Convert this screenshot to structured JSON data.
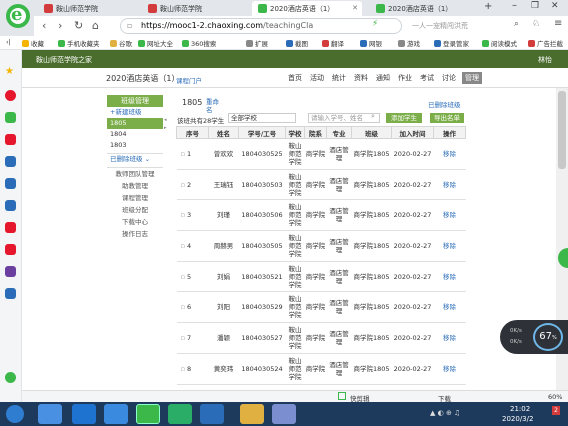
{
  "browser": {
    "tabs": [
      {
        "label": "鞍山师范学院",
        "active": false
      },
      {
        "label": "鞍山师范学院",
        "active": false
      },
      {
        "label": "2020酒店英语（1）",
        "active": true
      },
      {
        "label": "2020酒店英语（1）",
        "active": false
      }
    ],
    "url_host": "https://mooc1-2.chaoxing.com",
    "url_rest": "/teachingCla",
    "search_placeholder": "一人一宠精闯洪荒",
    "bookmarks": [
      "收藏",
      "手机收藏夹",
      "谷歌",
      "网址大全",
      "360搜索",
      "扩展",
      "截图",
      "翻译",
      "网银",
      "游戏",
      "登录管家",
      "阅读模式",
      "广告拦截"
    ]
  },
  "site": {
    "school": "鞍山师范学院之家",
    "user": "林怡"
  },
  "course": {
    "name": "2020酒店英语（1）",
    "portal": "课程门户",
    "nav": [
      "首页",
      "活动",
      "统计",
      "资料",
      "通知",
      "作业",
      "考试",
      "讨论",
      "管理"
    ],
    "active_nav": "管理"
  },
  "left_menu": {
    "header": "班级管理",
    "new_class": "+新建班级",
    "classes": [
      "1805",
      "1804",
      "1803"
    ],
    "selected_class": "1805",
    "closed_classes": "已删除班级 ⌄",
    "links": [
      "教师团队管理",
      "助教管理",
      "课程管理",
      "班级分配",
      "下载中心",
      "操作日志"
    ]
  },
  "class_panel": {
    "title": "1805",
    "rename": "重命名",
    "deleted_classes_link": "已删除班级",
    "student_count_text": "该班共有28学生",
    "school_filter": "全部学校",
    "search_placeholder": "请输入学号、姓名",
    "add_student": "添加学生",
    "export": "导出名单"
  },
  "table": {
    "headers": [
      "序号",
      "姓名",
      "学号/工号",
      "学校",
      "院系",
      "专业",
      "班级",
      "加入时间",
      "操作"
    ],
    "rows": [
      {
        "no": "1",
        "name": "曾欢欢",
        "id": "1804030525",
        "school": "鞍山师范学院",
        "dept": "商学院",
        "major": "酒店管理",
        "cls": "商学院1805",
        "date": "2020-02-27",
        "action": "移除"
      },
      {
        "no": "2",
        "name": "王瑞钰",
        "id": "1804030503",
        "school": "鞍山师范学院",
        "dept": "商学院",
        "major": "酒店管理",
        "cls": "商学院1805",
        "date": "2020-02-27",
        "action": "移除"
      },
      {
        "no": "3",
        "name": "刘瑾",
        "id": "1804030506",
        "school": "鞍山师范学院",
        "dept": "商学院",
        "major": "酒店管理",
        "cls": "商学院1805",
        "date": "2020-02-27",
        "action": "移除"
      },
      {
        "no": "4",
        "name": "周赫男",
        "id": "1804030505",
        "school": "鞍山师范学院",
        "dept": "商学院",
        "major": "酒店管理",
        "cls": "商学院1805",
        "date": "2020-02-27",
        "action": "移除"
      },
      {
        "no": "5",
        "name": "刘娟",
        "id": "1804030521",
        "school": "鞍山师范学院",
        "dept": "商学院",
        "major": "酒店管理",
        "cls": "商学院1805",
        "date": "2020-02-27",
        "action": "移除"
      },
      {
        "no": "6",
        "name": "刘阳",
        "id": "1804030529",
        "school": "鞍山师范学院",
        "dept": "商学院",
        "major": "酒店管理",
        "cls": "商学院1805",
        "date": "2020-02-27",
        "action": "移除"
      },
      {
        "no": "7",
        "name": "潘颖",
        "id": "1804030527",
        "school": "鞍山师范学院",
        "dept": "商学院",
        "major": "酒店管理",
        "cls": "商学院1805",
        "date": "2020-02-27",
        "action": "移除"
      },
      {
        "no": "8",
        "name": "黄奕玮",
        "id": "1804030524",
        "school": "鞍山师范学院",
        "dept": "商学院",
        "major": "酒店管理",
        "cls": "商学院1805",
        "date": "2020-02-27",
        "action": "移除"
      }
    ]
  },
  "status_bar": {
    "left": "快剪辑",
    "download": "下载",
    "zoom": "60%"
  },
  "net_widget": {
    "up": "0K/s",
    "down": "0K/s",
    "percent": "67",
    "unit": "%"
  },
  "taskbar": {
    "time": "21:02",
    "date": "2020/3/2"
  },
  "colors": {
    "accent_green": "#7bae48",
    "header_green": "#4a6d2e",
    "link_blue": "#2a6cb8"
  }
}
